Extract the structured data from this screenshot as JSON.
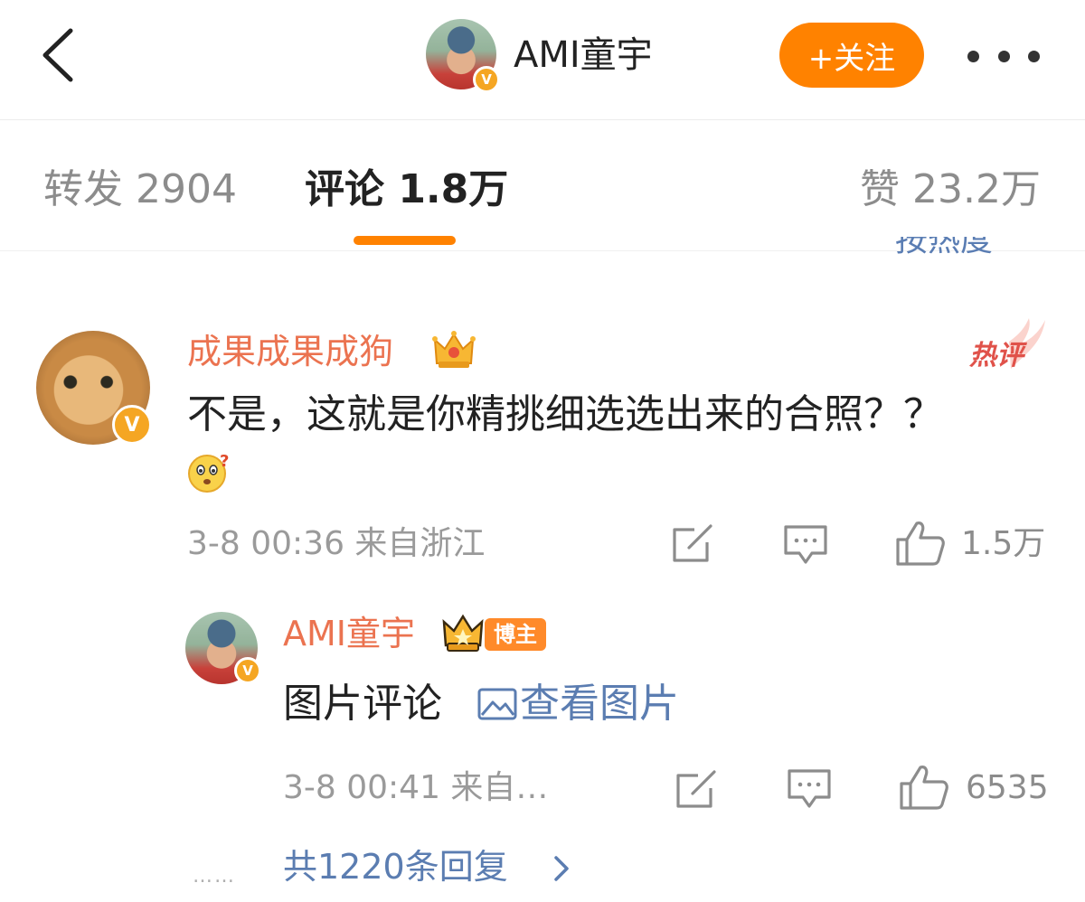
{
  "header": {
    "author_name": "AMI童宇",
    "follow_label": "+关注",
    "verified_glyph": "V"
  },
  "tabs": {
    "repost": "转发 2904",
    "comment": "评论 1.8万",
    "like": "赞 23.2万",
    "sort_hint": "按热度"
  },
  "comment": {
    "username": "成果成果成狗",
    "hot_label": "热评",
    "text": "不是，这就是你精挑细选选出来的合照？？",
    "emoji": "doubt-face-emoji",
    "time_location": "3-8 00:36 来自浙江",
    "like_count": "1.5万"
  },
  "reply": {
    "username": "AMI童宇",
    "badge": "博主",
    "text": "图片评论",
    "view_pic_label": "查看图片",
    "time_location": "3-8 00:41 来自…",
    "like_count": "6535"
  },
  "replies_footer": {
    "dots": "……",
    "label": "共1220条回复"
  },
  "colors": {
    "accent": "#ff8200",
    "username": "#eb7350",
    "link": "#5b7db1",
    "verified": "#f5a623"
  }
}
